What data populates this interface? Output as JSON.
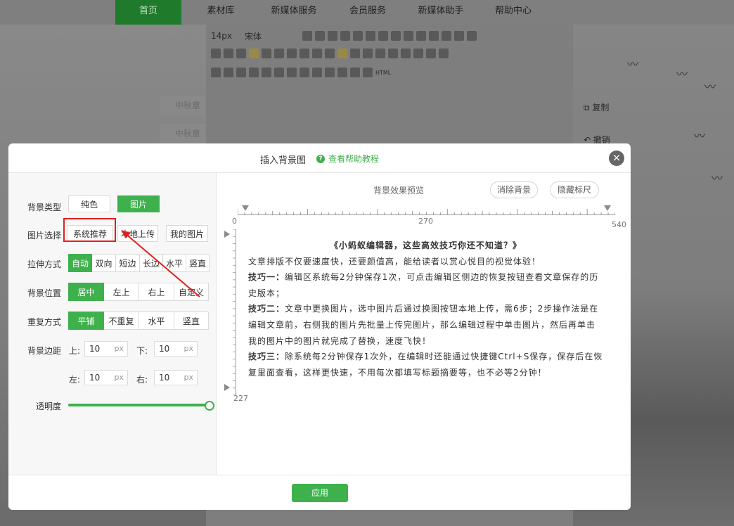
{
  "nav": {
    "items": [
      "首页",
      "素材库",
      "新媒体服务",
      "会员服务",
      "新媒体助手",
      "帮助中心"
    ]
  },
  "toolbar": {
    "font_size": "14px",
    "font_family": "宋体",
    "html_label": "HTML"
  },
  "side_tags": [
    "中秋意",
    "中秋意"
  ],
  "side_actions": {
    "copy": "复制",
    "undo": "撤销"
  },
  "modal": {
    "title": "插入背景图",
    "help_link": "查看帮助教程",
    "close_symbol": "×",
    "labels": {
      "bg_type": "背景类型",
      "image_select": "图片选择",
      "stretch": "拉伸方式",
      "position": "背景位置",
      "repeat": "重复方式",
      "margin": "背景边距",
      "opacity": "透明度"
    },
    "bg_type_options": [
      "纯色",
      "图片"
    ],
    "image_select_options": [
      "系统推荐",
      "本地上传",
      "我的图片"
    ],
    "stretch_options": [
      "自动",
      "双向",
      "短边",
      "长边",
      "水平",
      "竖直"
    ],
    "position_options": [
      "居中",
      "左上",
      "右上",
      "自定义"
    ],
    "repeat_options": [
      "平铺",
      "不重复",
      "水平",
      "竖直"
    ],
    "margin": {
      "top_label": "上:",
      "top_value": "10",
      "bottom_label": "下:",
      "bottom_value": "10",
      "left_label": "左:",
      "left_value": "10",
      "right_label": "右:",
      "right_value": "10",
      "unit": "px"
    },
    "opacity_value": 1.0,
    "preview": {
      "title": "背景效果预览",
      "clear_bg": "消除背景",
      "hide_ruler": "隐藏标尺",
      "ruler_start": "0",
      "ruler_mid": "270",
      "ruler_end": "540",
      "ruler_v_end": "227"
    },
    "article": {
      "title": "《小蚂蚁编辑器，这些高效技巧你还不知道？》",
      "intro": "文章排版不仅要速度快，还要颜值高，能给读者以赏心悦目的视觉体验！",
      "tip1_label": "技巧一：",
      "tip1": "编辑区系统每2分钟保存1次，可点击编辑区侧边的恢复按钮查看文章保存的历史版本；",
      "tip2_label": "技巧二：",
      "tip2": "文章中更换图片，选中图片后通过换图按钮本地上传，需6步；2步操作法是在编辑文章前，右侧我的图片先批量上传完图片，那么编辑过程中单击图片，然后再单击我的图片中的图片就完成了替换，速度飞快！",
      "tip3_label": "技巧三：",
      "tip3": "除系统每2分钟保存1次外，在编辑时还能通过快捷键Ctrl+S保存，保存后在恢复里面查看，这样更快速，不用每次都填写标题摘要等，也不必等2分钟！"
    },
    "apply": "应用",
    "colors": {
      "accent": "#3fb14c",
      "annotation": "#e1201d"
    }
  }
}
